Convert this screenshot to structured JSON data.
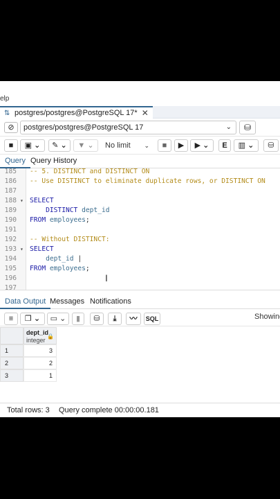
{
  "menu": {
    "help_label": "elp"
  },
  "doc_tab": {
    "title": "postgres/postgres@PostgreSQL 17*",
    "close": "✕"
  },
  "connection": {
    "selected": "postgres/postgres@PostgreSQL 17"
  },
  "toolbar": {
    "limit_label": "No limit"
  },
  "query_tabs": [
    "Query",
    "Query History"
  ],
  "editor": {
    "lines": [
      {
        "n": "185",
        "parts": [
          [
            "cm",
            "-- 5. DISTINCT and DISTINCT ON"
          ]
        ]
      },
      {
        "n": "186",
        "parts": [
          [
            "cm",
            "-- Use DISTINCT to eliminate duplicate rows, or DISTINCT ON"
          ]
        ]
      },
      {
        "n": "187",
        "parts": []
      },
      {
        "n": "188",
        "fold": "▾",
        "parts": [
          [
            "kw",
            "SELECT"
          ]
        ]
      },
      {
        "n": "189",
        "parts": [
          [
            "pl",
            "    "
          ],
          [
            "kw",
            "DISTINCT"
          ],
          [
            "pl",
            " "
          ],
          [
            "id",
            "dept_id"
          ]
        ]
      },
      {
        "n": "190",
        "parts": [
          [
            "kw",
            "FROM"
          ],
          [
            "pl",
            " "
          ],
          [
            "id",
            "employees"
          ],
          [
            "pl",
            ";"
          ]
        ]
      },
      {
        "n": "191",
        "parts": []
      },
      {
        "n": "192",
        "parts": [
          [
            "cm",
            "-- Without DISTINCT:"
          ]
        ]
      },
      {
        "n": "193",
        "fold": "▾",
        "parts": [
          [
            "kw",
            "SELECT"
          ]
        ]
      },
      {
        "n": "194",
        "parts": [
          [
            "pl",
            "    "
          ],
          [
            "id",
            "dept_id"
          ],
          [
            "pl",
            " |"
          ]
        ]
      },
      {
        "n": "195",
        "parts": [
          [
            "kw",
            "FROM"
          ],
          [
            "pl",
            " "
          ],
          [
            "id",
            "employees"
          ],
          [
            "pl",
            ";"
          ]
        ]
      },
      {
        "n": "196",
        "parts": []
      },
      {
        "n": "197",
        "parts": []
      }
    ]
  },
  "output_tabs": [
    "Data Output",
    "Messages",
    "Notifications"
  ],
  "output_toolbar": {
    "showing_label": "Showing",
    "sql_label": "SQL"
  },
  "grid": {
    "column": {
      "name": "dept_id",
      "type": "integer"
    },
    "rows": [
      {
        "row": "1",
        "value": "3"
      },
      {
        "row": "2",
        "value": "2"
      },
      {
        "row": "3",
        "value": "1"
      }
    ]
  },
  "status": {
    "total_rows": "Total rows: 3",
    "query_complete": "Query complete 00:00:00.181"
  }
}
